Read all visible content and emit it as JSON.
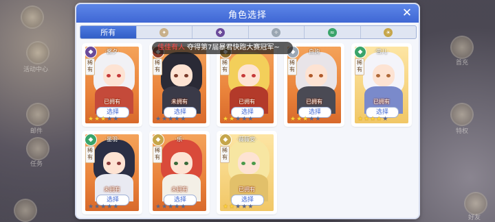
{
  "dialog": {
    "title": "角色选择",
    "close_label": "✕"
  },
  "tabs": [
    {
      "label": "所有",
      "active": true,
      "icon": "all"
    },
    {
      "label": "",
      "icon": "earth-element-icon",
      "color": "#c8b08a"
    },
    {
      "label": "",
      "icon": "dark-element-icon",
      "color": "#6a4a9a"
    },
    {
      "label": "",
      "icon": "sky-element-icon",
      "color": "#9aa6b2"
    },
    {
      "label": "",
      "icon": "wind-element-icon",
      "color": "#3aa46a"
    },
    {
      "label": "",
      "icon": "light-element-icon",
      "color": "#c6a64a"
    }
  ],
  "banner": {
    "highlight": "佳佳有人",
    "text": "夺得第7届暴君快跑大赛冠军~"
  },
  "cards": [
    {
      "name": "·酱夕·",
      "rarity": "稀有",
      "status": "已拥有",
      "button": "选择",
      "stars": 3,
      "max_stars": 5,
      "element_color": "#6a4a9a",
      "frame": "orange",
      "hair": "#f1f1f5",
      "body": "#c44a3a",
      "eye": "#c63a3a"
    },
    {
      "name": "",
      "rarity": "稀有",
      "status": "未拥有",
      "button": "选择",
      "stars": 0,
      "max_stars": 5,
      "element_color": "#8a3a2a",
      "frame": "orange",
      "hair": "#2a2a36",
      "body": "#3a3a48",
      "eye": "#7a3a2a"
    },
    {
      "name": "",
      "rarity": "稀有",
      "status": "已拥有",
      "button": "选择",
      "stars": 2,
      "max_stars": 5,
      "element_color": "#8a6a2a",
      "frame": "orange",
      "hair": "#f3cf5a",
      "body": "#b33a2a",
      "eye": "#c63a3a"
    },
    {
      "name": "白驹",
      "rarity": "稀有",
      "status": "已拥有",
      "button": "选择",
      "stars": 3,
      "max_stars": 5,
      "element_color": "#9aa6b2",
      "frame": "orange",
      "hair": "#e8e4e8",
      "body": "#4a4a54",
      "eye": "#b05a2a"
    },
    {
      "name": "·雪儿·",
      "rarity": "稀有",
      "status": "已拥有",
      "button": "选择",
      "stars": 4,
      "max_stars": 5,
      "element_color": "#3aa46a",
      "frame": "gold",
      "hair": "#f4f4fa",
      "body": "#7a8acb",
      "eye": "#b06a3a"
    },
    {
      "name": "·墨羽·",
      "rarity": "稀有",
      "status": "未拥有",
      "button": "选择",
      "stars": 0,
      "max_stars": 5,
      "element_color": "#3aa46a",
      "frame": "orange",
      "hair": "#2b2f45",
      "body": "#e9eaf2",
      "eye": "#8a3a3a"
    },
    {
      "name": "·乐·",
      "rarity": "稀有",
      "status": "未拥有",
      "button": "选择",
      "stars": 0,
      "max_stars": 5,
      "element_color": "#c6a64a",
      "frame": "orange",
      "hair": "#d94a3a",
      "body": "#f3efe6",
      "eye": "#3a6a3a"
    },
    {
      "name": "·薇薇安·",
      "rarity": "稀有",
      "status": "已拥有",
      "button": "选择",
      "stars": 2,
      "max_stars": 5,
      "element_color": "#c6a64a",
      "frame": "gold",
      "hair": "#f7e6a2",
      "body": "#e2c06a",
      "eye": "#4a9a4a"
    }
  ],
  "background": {
    "left_labels": [
      "活动中心",
      "邮件",
      "任务"
    ],
    "right_labels": [
      "首充",
      "特权",
      "好友"
    ]
  }
}
